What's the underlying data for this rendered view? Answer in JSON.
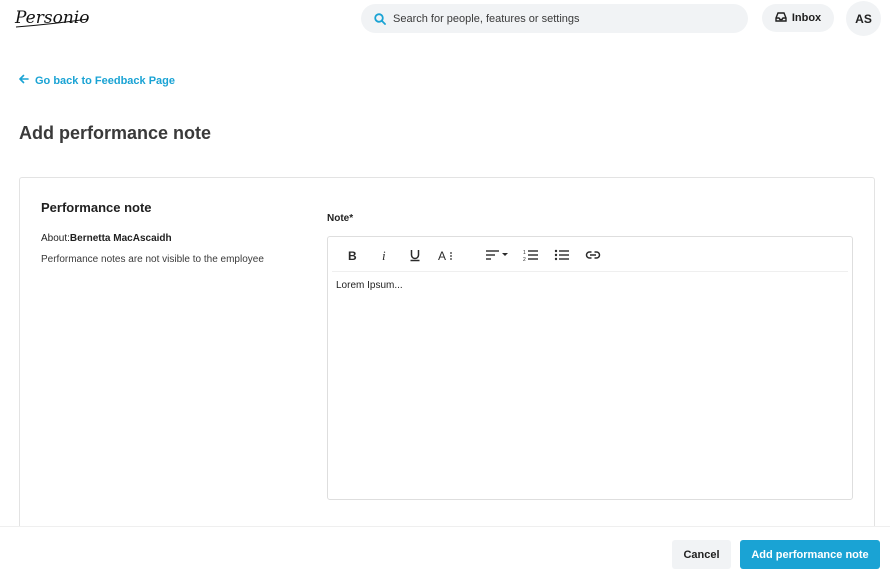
{
  "header": {
    "logo_text": "Personio",
    "search_placeholder": "Search for people, features or settings",
    "inbox_label": "Inbox",
    "avatar_initials": "AS"
  },
  "nav": {
    "back_label": "Go back to Feedback Page"
  },
  "page": {
    "title": "Add performance note"
  },
  "card": {
    "title": "Performance note",
    "about_label": "About:",
    "about_name": "Bernetta MacAscaidh",
    "hint": "Performance notes are not visible to the employee",
    "note_label": "Note*",
    "note_text": "Lorem Ipsum..."
  },
  "toolbar": {
    "icons": [
      "bold-icon",
      "italic-icon",
      "underline-icon",
      "text-size-icon",
      "align-icon",
      "ordered-list-icon",
      "bullet-list-icon",
      "link-icon"
    ]
  },
  "footer": {
    "cancel_label": "Cancel",
    "submit_label": "Add performance note"
  },
  "colors": {
    "accent": "#1aa3d4",
    "surface": "#f1f3f5",
    "text": "#1f1f1f"
  }
}
